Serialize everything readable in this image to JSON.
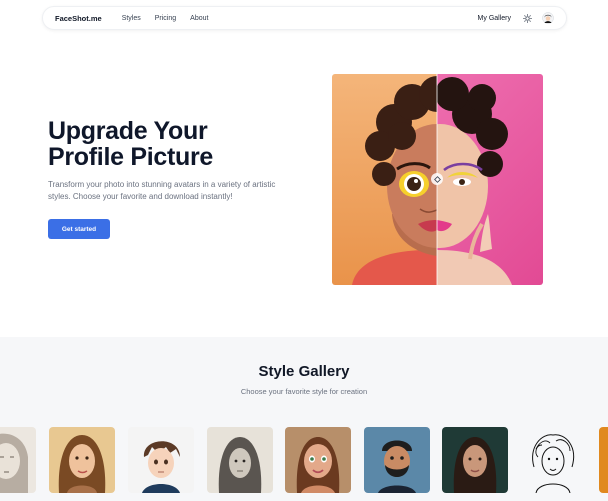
{
  "nav": {
    "brand": "FaceShot.me",
    "links": [
      "Styles",
      "Pricing",
      "About"
    ],
    "my_gallery": "My Gallery",
    "theme_icon": "sun-icon",
    "avatar_icon": "user-avatar-icon"
  },
  "hero": {
    "title_line1": "Upgrade Your",
    "title_line2": "Profile Picture",
    "subtitle": "Transform your photo into stunning avatars in a variety of artistic styles. Choose your favorite and download instantly!",
    "cta_label": "Get started"
  },
  "gallery": {
    "title": "Style Gallery",
    "subtitle": "Choose your favorite style for creation",
    "styles": [
      "pencil-sketch",
      "warm-painting",
      "anime",
      "charcoal",
      "3d-cartoon",
      "3d-cartoon-man",
      "realistic-photo",
      "line-art"
    ]
  },
  "colors": {
    "accent": "#3b6fe6",
    "hero_left_bg": "#f0a868",
    "hero_right_bg": "#e85aa0",
    "gallery_bg": "#f6f7f9"
  }
}
